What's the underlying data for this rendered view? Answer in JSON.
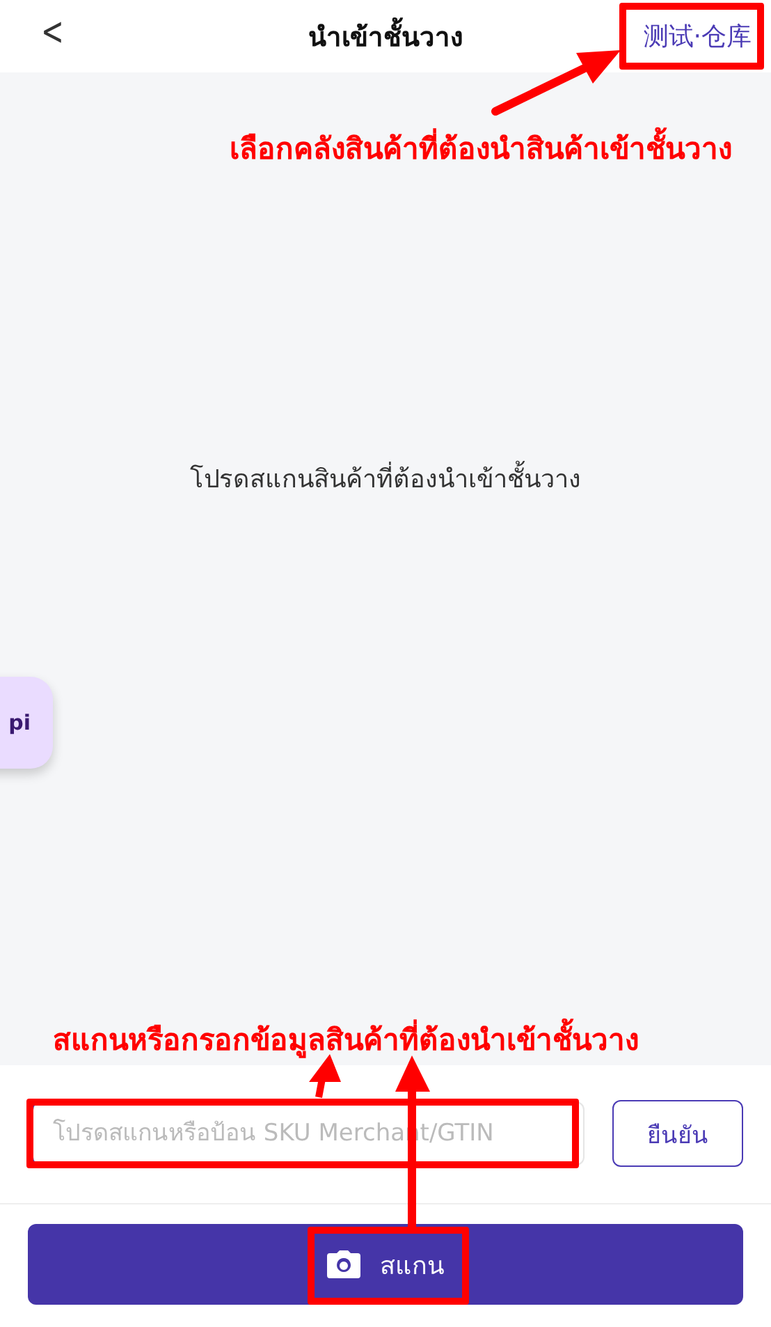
{
  "header": {
    "back": "<",
    "title": "นำเข้าชั้นวาง",
    "warehouse": "测试·仓库"
  },
  "content": {
    "message": "โปรดสแกนสินค้าที่ต้องนำเข้าชั้นวาง"
  },
  "floating_button": {
    "label": "pi"
  },
  "input": {
    "placeholder": "โปรดสแกนหรือป้อน SKU Merchant/GTIN",
    "confirm": "ยืนยัน"
  },
  "scan_button": {
    "label": "สแกน"
  },
  "annotations": [
    {
      "kind": "top",
      "text": "เลือกคลังสินค้าที่ต้องนำสินค้าเข้าชั้นวาง"
    },
    {
      "kind": "bottom",
      "text": "สแกนหรือกรอกข้อมูลสินค้าที่ต้องนำเข้าชั้นวาง"
    }
  ]
}
